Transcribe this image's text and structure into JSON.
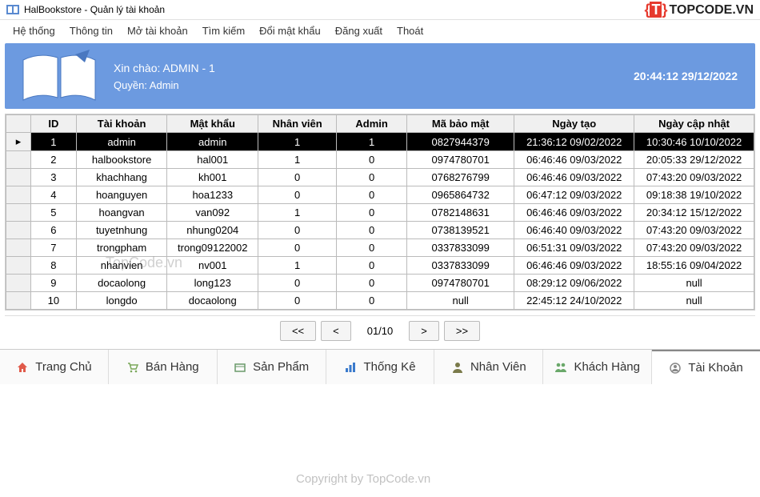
{
  "title": "HalBookstore - Quản lý tài khoản",
  "brand_logo": "TOPCODE.VN",
  "menubar": {
    "items": [
      "Hệ thống",
      "Thông tin",
      "Mở tài khoản",
      "Tìm kiếm",
      "Đổi mật khẩu",
      "Đăng xuất",
      "Thoát"
    ]
  },
  "banner": {
    "greeting": "Xin chào: ADMIN - 1",
    "role": "Quyền: Admin",
    "datetime": "20:44:12 29/12/2022"
  },
  "table": {
    "headers": [
      "ID",
      "Tài khoản",
      "Mật khẩu",
      "Nhân viên",
      "Admin",
      "Mã bảo mật",
      "Ngày tạo",
      "Ngày cập nhật"
    ],
    "rows": [
      {
        "selected": true,
        "cells": [
          "1",
          "admin",
          "admin",
          "1",
          "1",
          "0827944379",
          "21:36:12 09/02/2022",
          "10:30:46 10/10/2022"
        ],
        "marker": "▸"
      },
      {
        "selected": false,
        "cells": [
          "2",
          "halbookstore",
          "hal001",
          "1",
          "0",
          "0974780701",
          "06:46:46 09/03/2022",
          "20:05:33 29/12/2022"
        ]
      },
      {
        "selected": false,
        "cells": [
          "3",
          "khachhang",
          "kh001",
          "0",
          "0",
          "0768276799",
          "06:46:46 09/03/2022",
          "07:43:20 09/03/2022"
        ]
      },
      {
        "selected": false,
        "cells": [
          "4",
          "hoanguyen",
          "hoa1233",
          "0",
          "0",
          "0965864732",
          "06:47:12 09/03/2022",
          "09:18:38 19/10/2022"
        ]
      },
      {
        "selected": false,
        "cells": [
          "5",
          "hoangvan",
          "van092",
          "1",
          "0",
          "0782148631",
          "06:46:46 09/03/2022",
          "20:34:12 15/12/2022"
        ]
      },
      {
        "selected": false,
        "cells": [
          "6",
          "tuyetnhung",
          "nhung0204",
          "0",
          "0",
          "0738139521",
          "06:46:40 09/03/2022",
          "07:43:20 09/03/2022"
        ]
      },
      {
        "selected": false,
        "cells": [
          "7",
          "trongpham",
          "trong09122002",
          "0",
          "0",
          "0337833099",
          "06:51:31 09/03/2022",
          "07:43:20 09/03/2022"
        ]
      },
      {
        "selected": false,
        "cells": [
          "8",
          "nhanvien",
          "nv001",
          "1",
          "0",
          "0337833099",
          "06:46:46 09/03/2022",
          "18:55:16 09/04/2022"
        ]
      },
      {
        "selected": false,
        "cells": [
          "9",
          "docaolong",
          "long123",
          "0",
          "0",
          "0974780701",
          "08:29:12 09/06/2022",
          "null"
        ]
      },
      {
        "selected": false,
        "cells": [
          "10",
          "longdo",
          "docaolong",
          "0",
          "0",
          "null",
          "22:45:12 24/10/2022",
          "null"
        ]
      }
    ]
  },
  "pager": {
    "first": "<<",
    "prev": "<",
    "indicator": "01/10",
    "next": ">",
    "last": ">>"
  },
  "tabs": [
    {
      "label": "Trang Chủ",
      "icon": "home-icon",
      "color": "#e05a4a"
    },
    {
      "label": "Bán Hàng",
      "icon": "cart-icon",
      "color": "#7aa85a"
    },
    {
      "label": "Sản Phẩm",
      "icon": "product-icon",
      "color": "#6a9a6a"
    },
    {
      "label": "Thống Kê",
      "icon": "chart-icon",
      "color": "#3a7acc"
    },
    {
      "label": "Nhân Viên",
      "icon": "staff-icon",
      "color": "#7a7a4a"
    },
    {
      "label": "Khách Hàng",
      "icon": "customers-icon",
      "color": "#6aa86a"
    },
    {
      "label": "Tài Khoản",
      "icon": "account-icon",
      "color": "#888",
      "active": true
    }
  ],
  "watermarks": {
    "wm1": "TopCode.vn",
    "wm2": "Copyright by TopCode.vn"
  }
}
